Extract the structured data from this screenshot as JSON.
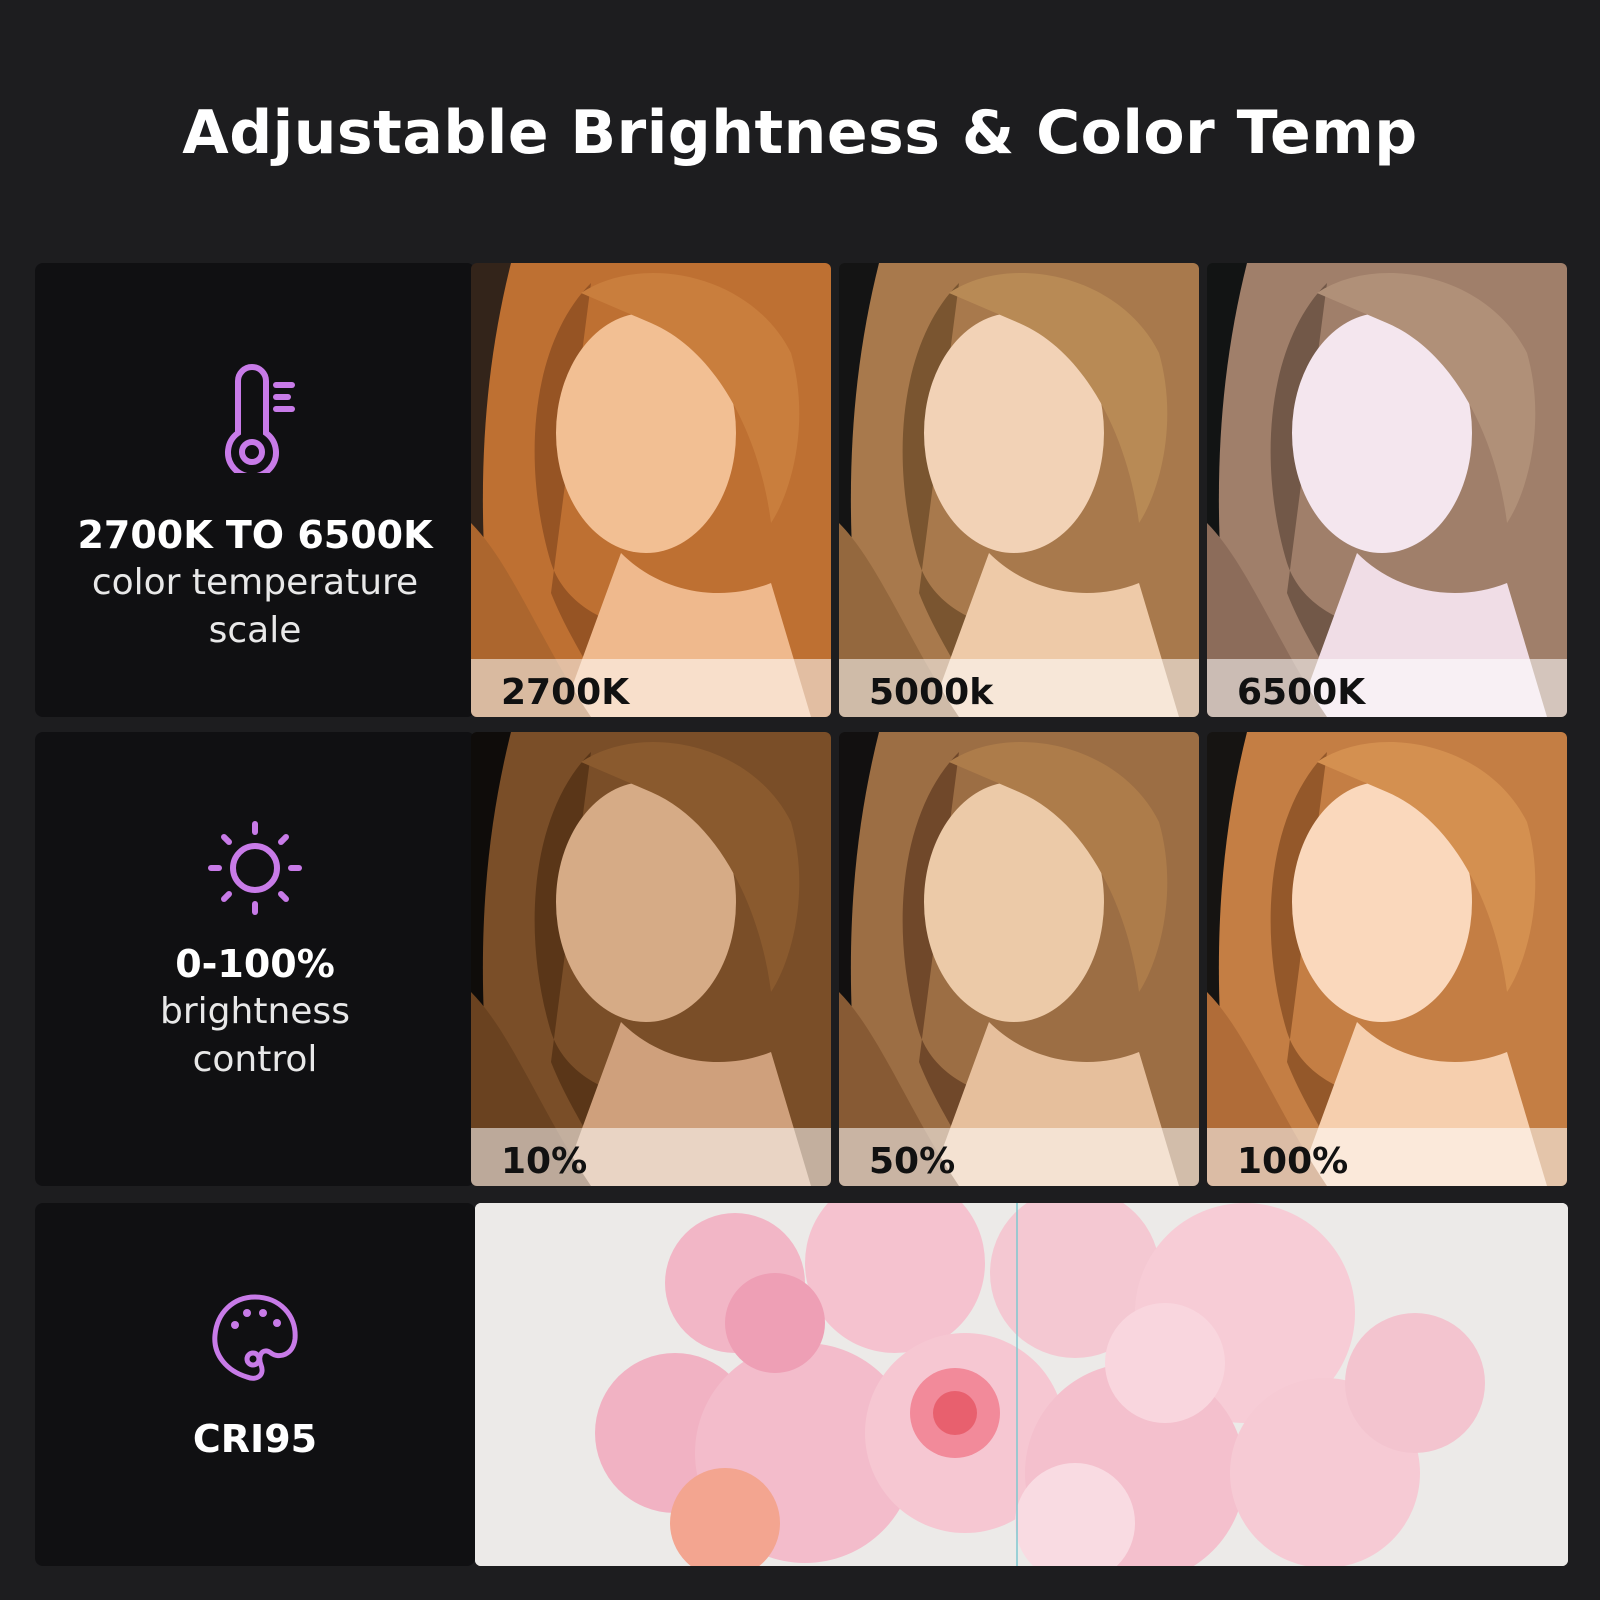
{
  "title": "Adjustable Brightness & Color Temp",
  "accent_color": "#c87be8",
  "color_temperature": {
    "icon": "thermometer-icon",
    "range_label": "2700K TO 6500K",
    "description": "color temperature\nscale",
    "samples": [
      {
        "label": "2700K",
        "tint": "#f0a060"
      },
      {
        "label": "5000k",
        "tint": "#e8b890"
      },
      {
        "label": "6500K",
        "tint": "#e8d8e8"
      }
    ]
  },
  "brightness": {
    "icon": "sun-icon",
    "range_label": "0-100%",
    "description": "brightness\ncontrol",
    "samples": [
      {
        "label": "10%",
        "level": 0.1
      },
      {
        "label": "50%",
        "level": 0.5
      },
      {
        "label": "100%",
        "level": 1.0
      }
    ]
  },
  "cri": {
    "icon": "palette-icon",
    "label": "CRI95"
  }
}
